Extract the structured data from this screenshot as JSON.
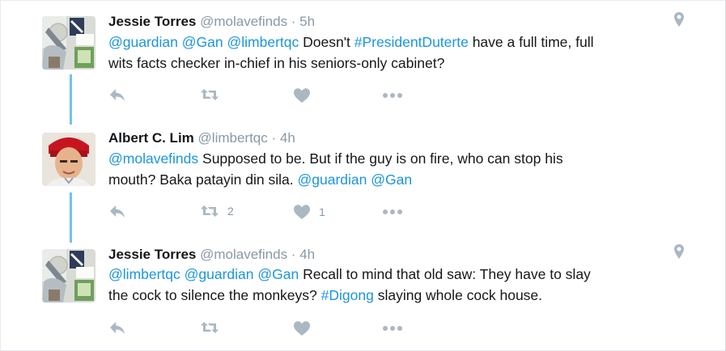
{
  "tweets": [
    {
      "fullname": "Jessie Torres",
      "handle": "@molavefinds",
      "time": " · 5h",
      "text": [
        [
          {
            "t": "@guardian",
            "link": true
          },
          {
            "t": " ",
            "link": false
          },
          {
            "t": "@Gan",
            "link": true
          },
          {
            "t": " ",
            "link": false
          },
          {
            "t": "@limbertqc",
            "link": true
          },
          {
            "t": " Doesn't ",
            "link": false
          },
          {
            "t": "#PresidentDuterte",
            "link": true
          },
          {
            "t": " have a full time, full",
            "link": false
          }
        ],
        [
          {
            "t": "wits facts checker in-chief in his seniors-only cabinet?",
            "link": false
          }
        ]
      ],
      "retweet_count": "",
      "like_count": "",
      "has_geo": true
    },
    {
      "fullname": "Albert C. Lim",
      "handle": "@limbertqc",
      "time": " · 4h",
      "text": [
        [
          {
            "t": "@molavefinds",
            "link": true
          },
          {
            "t": " Supposed to be. But if the guy is on fire, who can stop his",
            "link": false
          }
        ],
        [
          {
            "t": "mouth? Baka patayin din sila. ",
            "link": false
          },
          {
            "t": "@guardian",
            "link": true
          },
          {
            "t": " ",
            "link": false
          },
          {
            "t": "@Gan",
            "link": true
          }
        ]
      ],
      "retweet_count": "2",
      "like_count": "1",
      "has_geo": false
    },
    {
      "fullname": "Jessie Torres",
      "handle": "@molavefinds",
      "time": " · 4h",
      "text": [
        [
          {
            "t": "@limbertqc",
            "link": true
          },
          {
            "t": " ",
            "link": false
          },
          {
            "t": "@guardian",
            "link": true
          },
          {
            "t": " ",
            "link": false
          },
          {
            "t": "@Gan",
            "link": true
          },
          {
            "t": " Recall to mind that old saw: They have to slay",
            "link": false
          }
        ],
        [
          {
            "t": "the cock to silence the monkeys? ",
            "link": false
          },
          {
            "t": "#Digong",
            "link": true
          },
          {
            "t": " slaying whole cock house.",
            "link": false
          }
        ]
      ],
      "retweet_count": "",
      "like_count": "",
      "has_geo": true
    }
  ],
  "icons": {
    "reply": "reply-icon",
    "retweet": "retweet-icon",
    "like": "heart-icon",
    "more": "more-icon",
    "geo": "location-pin-icon"
  },
  "colors": {
    "link": "#1b95e0",
    "muted": "#8899a6",
    "icon": "#aab8c2",
    "thread_line": "#72c2e8"
  }
}
